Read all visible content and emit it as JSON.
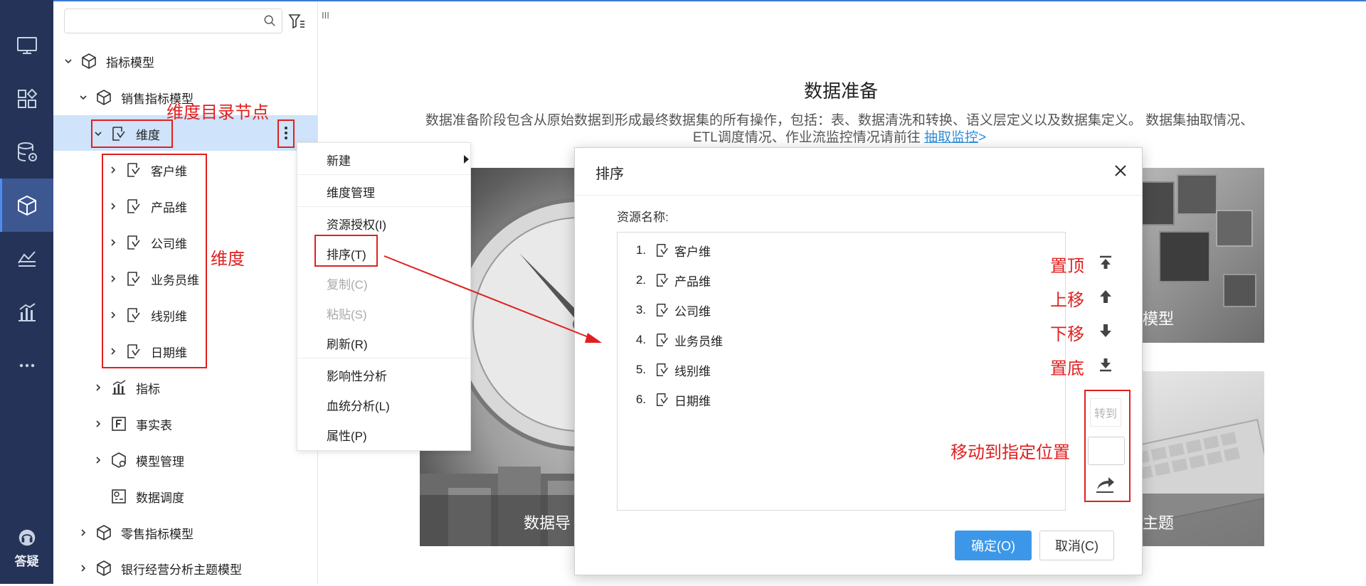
{
  "search": {
    "placeholder": "",
    "value": ""
  },
  "tree": {
    "root": "指标模型",
    "sales_model": "销售指标模型",
    "dimension": "维度",
    "dimension_children": [
      "客户维",
      "产品维",
      "公司维",
      "业务员维",
      "线别维",
      "日期维"
    ],
    "metrics": "指标",
    "fact_table": "事实表",
    "model_manage": "模型管理",
    "data_schedule": "数据调度",
    "retail_model": "零售指标模型",
    "bank_model": "银行经营分析主题模型"
  },
  "rail": {
    "help_label": "答疑"
  },
  "main": {
    "panel_toggle": "III",
    "title": "数据准备",
    "desc_line1": "数据准备阶段包含从原始数据到形成最终数据集的所有操作，包括：表、数据清洗和转换、语义层定义以及数据集定义。 数据集抽取情况、",
    "desc_line2": "ETL调度情况、作业流监控情况请前往 ",
    "desc_link": "抽取监控",
    "desc_arrow": ">",
    "card_labels": [
      "数据导",
      "模型",
      "主题"
    ]
  },
  "context_menu": {
    "new": "新建",
    "dimension_manage": "维度管理",
    "auth": "资源授权(I)",
    "sort": "排序(T)",
    "copy": "复制(C)",
    "paste": "粘贴(S)",
    "refresh": "刷新(R)",
    "impact": "影响性分析",
    "lineage": "血统分析(L)",
    "props": "属性(P)"
  },
  "dialog": {
    "title": "排序",
    "resource_label": "资源名称:",
    "items": [
      {
        "num": "1.",
        "name": "客户维"
      },
      {
        "num": "2.",
        "name": "产品维"
      },
      {
        "num": "3.",
        "name": "公司维"
      },
      {
        "num": "4.",
        "name": "业务员维"
      },
      {
        "num": "5.",
        "name": "线别维"
      },
      {
        "num": "6.",
        "name": "日期维"
      }
    ],
    "goto_label": "转到",
    "ok": "确定(O)",
    "cancel": "取消(C)"
  },
  "annotations": {
    "dimension_dir_node": "维度目录节点",
    "dimension": "维度",
    "to_top": "置顶",
    "move_up": "上移",
    "move_down": "下移",
    "to_bottom": "置底",
    "move_to_position": "移动到指定位置"
  },
  "colors": {
    "rail_bg": "#243357",
    "rail_active": "#3d5790",
    "annotation_red": "#e02020",
    "primary_button": "#3c97e8",
    "selected_row": "#cfe3fa",
    "link": "#2f8ed8"
  }
}
